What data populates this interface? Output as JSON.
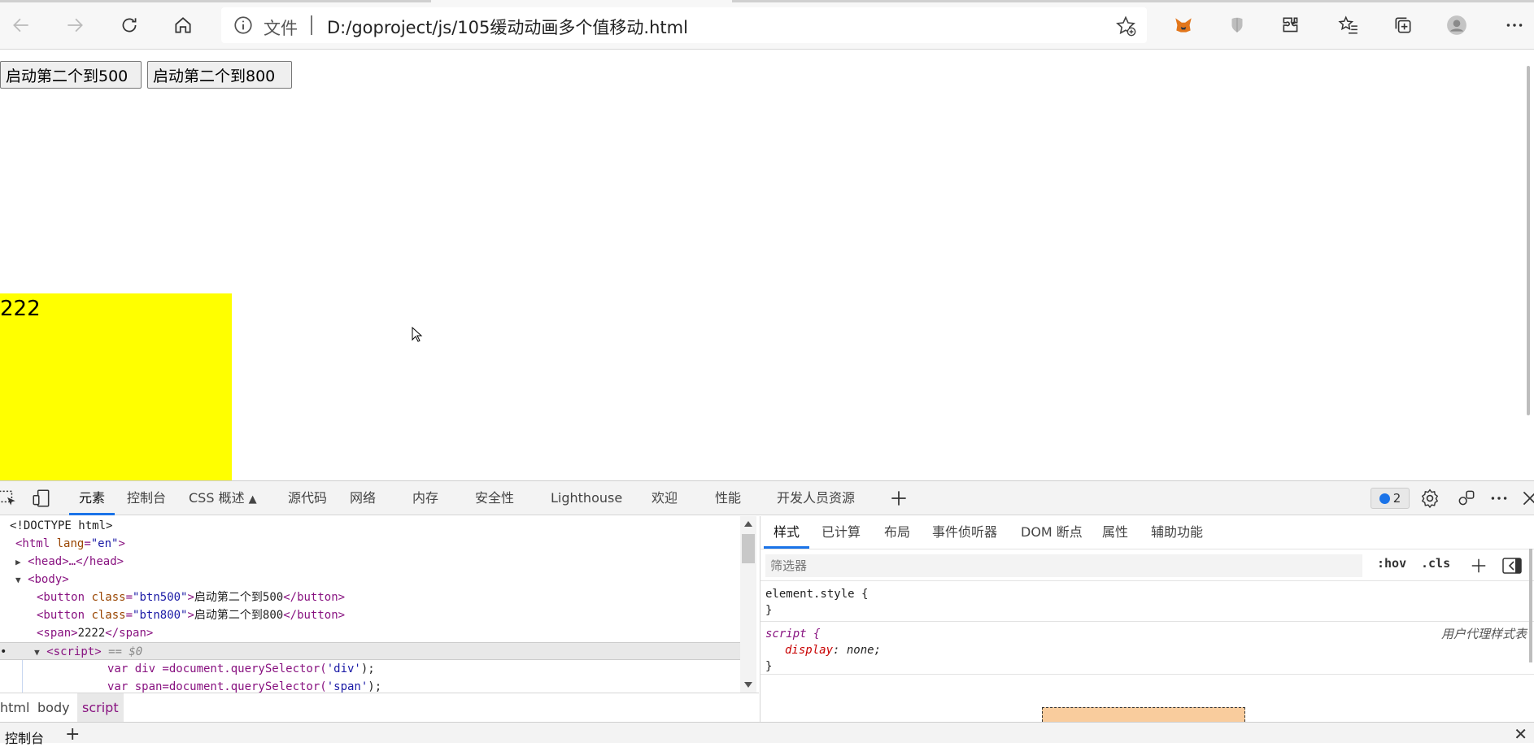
{
  "browser": {
    "file_label": "文件",
    "url": "D:/goproject/js/105缓动动画多个值移动.html"
  },
  "page": {
    "buttons": [
      "启动第二个到500",
      "启动第二个到800"
    ],
    "box_text": "222",
    "box_color": "#ffff00"
  },
  "devtools": {
    "tabs": [
      "元素",
      "控制台",
      "CSS 概述",
      "源代码",
      "网络",
      "内存",
      "安全性",
      "Lighthouse",
      "欢迎",
      "性能",
      "开发人员资源"
    ],
    "issues_count": "2",
    "elements": {
      "doctype": "<!DOCTYPE html>",
      "html_open_tag": "<html",
      "html_lang_attr": "lang",
      "html_lang_val": "\"en\"",
      "head_collapsed": "<head>…</head>",
      "body_open": "<body>",
      "btn500_class": "\"btn500\"",
      "btn500_text": "启动第二个到500",
      "btn800_class": "\"btn800\"",
      "btn800_text": "启动第二个到800",
      "span_text": "2222",
      "script_tag": "<script>",
      "script_marker": "== $0",
      "code_line1_a": "var div =document.querySelector(",
      "code_line1_str": "'div'",
      "code_line1_b": ");",
      "code_line2_a": "var span=document.querySelector(",
      "code_line2_str": "'span'",
      "code_line2_b": ");"
    },
    "breadcrumb": [
      "html",
      "body",
      "script"
    ],
    "styles": {
      "tabs": [
        "样式",
        "已计算",
        "布局",
        "事件侦听器",
        "DOM 断点",
        "属性",
        "辅助功能"
      ],
      "filter_placeholder": "筛选器",
      "hov": ":hov",
      "cls": ".cls",
      "element_style": "element.style {",
      "close_brace": "}",
      "script_selector": "script {",
      "script_prop": "display",
      "script_val": "none;",
      "user_agent_label": "用户代理样式表"
    },
    "drawer": {
      "tab": "控制台"
    }
  }
}
